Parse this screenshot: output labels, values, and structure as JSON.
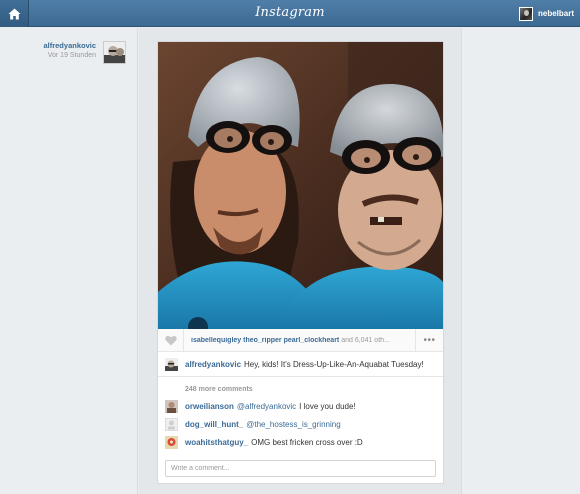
{
  "topbar": {
    "logo": "Instagram",
    "home_icon": "home-icon",
    "username": "nebelbart"
  },
  "post": {
    "author": "alfredyankovic",
    "time": "Vor 19 Stunden",
    "likes": {
      "likers": [
        "isabellequigley",
        "theo_ripper",
        "pearl_clockheart"
      ],
      "tail": "and 6,041 oth..."
    },
    "more_label": "•••",
    "caption": {
      "user": "alfredyankovic",
      "text": "Hey, kids! It's Dress-Up-Like-An-Aquabat Tuesday!"
    },
    "more_comments": "248 more comments",
    "comments": [
      {
        "user": "orweilianson",
        "mention": "@alfredyankovic",
        "text": "I love you dude!"
      },
      {
        "user": "dog_will_hunt_",
        "mention": "@the_hostess_is_grinning",
        "text": ""
      },
      {
        "user": "woahitsthatguy_",
        "mention": "",
        "text": "OMG best fricken cross over :D"
      }
    ],
    "comment_placeholder": "Write a comment..."
  },
  "colors": {
    "topbar": "#4a79a3",
    "link": "#3b6b96",
    "background": "#e9edf0"
  }
}
